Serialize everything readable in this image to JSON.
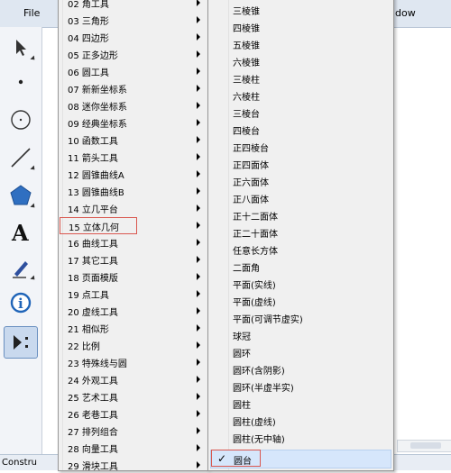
{
  "app": {
    "file_menu": "File",
    "view_menu_fragment": "dow",
    "bottom_label": "Constru",
    "tools": [
      {
        "name": "arrow-tool-icon",
        "active": false
      },
      {
        "name": "point-tool-icon",
        "active": false
      },
      {
        "name": "compass-tool-icon",
        "active": false
      },
      {
        "name": "line-tool-icon",
        "active": false
      },
      {
        "name": "polygon-tool-icon",
        "active": false
      },
      {
        "name": "text-tool-icon",
        "active": false
      },
      {
        "name": "marker-tool-icon",
        "active": false
      },
      {
        "name": "info-tool-icon",
        "active": false
      },
      {
        "name": "custom-tools-icon",
        "active": true
      }
    ]
  },
  "menu1": {
    "items": [
      {
        "label": "02 角工具"
      },
      {
        "label": "03 三角形"
      },
      {
        "label": "04 四边形"
      },
      {
        "label": "05 正多边形"
      },
      {
        "label": "06 圆工具"
      },
      {
        "label": "07 新新坐标系"
      },
      {
        "label": "08 迷你坐标系"
      },
      {
        "label": "09 经典坐标系"
      },
      {
        "label": "10 函数工具"
      },
      {
        "label": "11 箭头工具"
      },
      {
        "label": "12 圆锥曲线A"
      },
      {
        "label": "13 圆锥曲线B"
      },
      {
        "label": "14 立几平台"
      },
      {
        "label": "15 立体几何",
        "selected": true
      },
      {
        "label": "16 曲线工具"
      },
      {
        "label": "17 其它工具"
      },
      {
        "label": "18 页面模版"
      },
      {
        "label": "19 点工具"
      },
      {
        "label": "20 虚线工具"
      },
      {
        "label": "21 相似形"
      },
      {
        "label": "22 比例"
      },
      {
        "label": "23 特殊线与圆"
      },
      {
        "label": "24 外观工具"
      },
      {
        "label": "25 艺术工具"
      },
      {
        "label": "26 老巷工具"
      },
      {
        "label": "27 排列组合"
      },
      {
        "label": "28 向量工具"
      },
      {
        "label": "29 滑块工具"
      }
    ]
  },
  "menu2": {
    "items": [
      {
        "label": "三棱锥"
      },
      {
        "label": "四棱锥"
      },
      {
        "label": "五棱锥"
      },
      {
        "label": "六棱锥"
      },
      {
        "label": "三棱柱"
      },
      {
        "label": "六棱柱"
      },
      {
        "label": "三棱台"
      },
      {
        "label": "四棱台"
      },
      {
        "label": "正四棱台"
      },
      {
        "label": "正四面体"
      },
      {
        "label": "正六面体"
      },
      {
        "label": "正八面体"
      },
      {
        "label": "正十二面体"
      },
      {
        "label": "正二十面体"
      },
      {
        "label": "任意长方体"
      },
      {
        "label": "二面角"
      },
      {
        "label": "平面(实线)"
      },
      {
        "label": "平面(虚线)"
      },
      {
        "label": "平面(可调节虚实)"
      },
      {
        "label": "球冠"
      },
      {
        "label": "圆环"
      },
      {
        "label": "圆环(含阴影)"
      },
      {
        "label": "圆环(半虚半实)"
      },
      {
        "label": "圆柱"
      },
      {
        "label": "圆柱(虚线)"
      },
      {
        "label": "圆柱(无中轴)"
      },
      {
        "label": "圆台",
        "checked": true,
        "selected": true
      }
    ],
    "check_mark": "✓"
  }
}
